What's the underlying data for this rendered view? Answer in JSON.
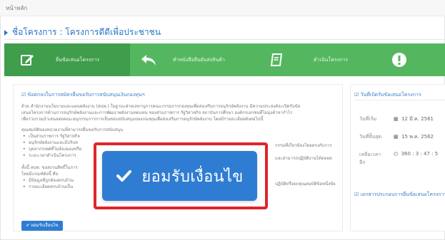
{
  "breadcrumb": {
    "home": "หน้าหลัก"
  },
  "header": {
    "title": "ชื่อโครงการ : โครงการดีดีเพื่อประชาชน"
  },
  "toolbar": {
    "items": [
      {
        "label": "ยื่นข้อเสนอโครงการ",
        "icon": "edit-icon"
      },
      {
        "label": "ทำหนังสือยืนยันส่งสินค้า",
        "icon": "reply-arrow-icon"
      },
      {
        "label": "ดำเนินโครงการ",
        "icon": "book-icon"
      },
      {
        "label": "",
        "icon": "exclamation-icon"
      }
    ]
  },
  "main": {
    "section_title": "ข้อตกลงในการสมัครยื่นขอรับการสนับสนุนเงินกองทุนฯ",
    "paragraphs": [
      "ด้วย สำนักงานนโยบายและแผนพลังงาน (สนพ.) ในฐานะฝ่ายเลขานุการคณะกรรมการกองทุนเพื่อส่งเสริมการอนุรักษ์พลังงาน มีความประสงค์จะเปิดรับข้อ",
      "เสนอโครงการด้านการอนุรักษ์พลังงานและการพัฒนาพลังงานทดแทน ของส่วนราชการ รัฐวิสาหกิจ สถาบันการศึกษา องค์กรเอกชนที่ไม่มุ่งค้าหากำไร",
      "เพื่อรวบรวมนำเสนอต่อคณะอนุกรรมการการเห็นชอบสนับสนุนของกองทุนเพื่อส่งเสริมการอนุรักษ์พลังงาน โดยมีรายละเอียดดังต่อไปนี้"
    ],
    "qualifications_title": "คุณสมบัติของหน่วยงานที่สามารถยื่นขอรับการสนับสนุน",
    "bullets": [
      "เป็นส่วนราชการ รัฐวิสาหกิจ",
      "อนุรักษ์พลังงานและมีบริบท",
      "บุคลากรเพศที่ไม่ต้องมองหรือ",
      "ระยะเวลาดำเนินโครงการ"
    ],
    "bullets_right": [
      "กรรมที่เกี่ยวข้องโดยตรงกับการ",
      "และสามารถปฏิบัติงานได้ตลอด"
    ],
    "closing": "ทั้งนี้ สนพ. ขอสงวนสิทธิ์ในการ",
    "closing_2": "โดยมีเกณฑ์ดังนี้ คือ",
    "closing_right": "ปฏิบัติหรือยกคุณสมบัติข้อหนึ่งข้อ",
    "closing_bullets": [
      "มีข้อมูลที่ถูกต้องครบถ้วน",
      "รายละเอียดครบถ้วนเป็น"
    ],
    "small_accept_label": "ยอมรับเงื่อนไข"
  },
  "sidebar": {
    "section_title": "วันที่เปิดรับข้อเสนอโครงการ",
    "rows": [
      {
        "label": "วันที่เริ่ม",
        "icon": "calendar-icon",
        "value": "12 มี.ค. 2561"
      },
      {
        "label": "วันที่สิ้นสุด",
        "icon": "calendar-icon",
        "value": "15 พ.ค. 2562"
      },
      {
        "label": "เหลือเวลา อีก",
        "icon": "clock-icon",
        "value": "360 : 3 : 47 : 5"
      }
    ],
    "footer_link": "เอกสารประกอบการยื่นข้อเสนอโครงการ"
  },
  "accept_button": {
    "label": "ยอมรับเงื่อนไข"
  },
  "colors": {
    "accent_green": "#54b760",
    "accent_blue": "#2f7dd2",
    "highlight_red": "#e0252b"
  }
}
